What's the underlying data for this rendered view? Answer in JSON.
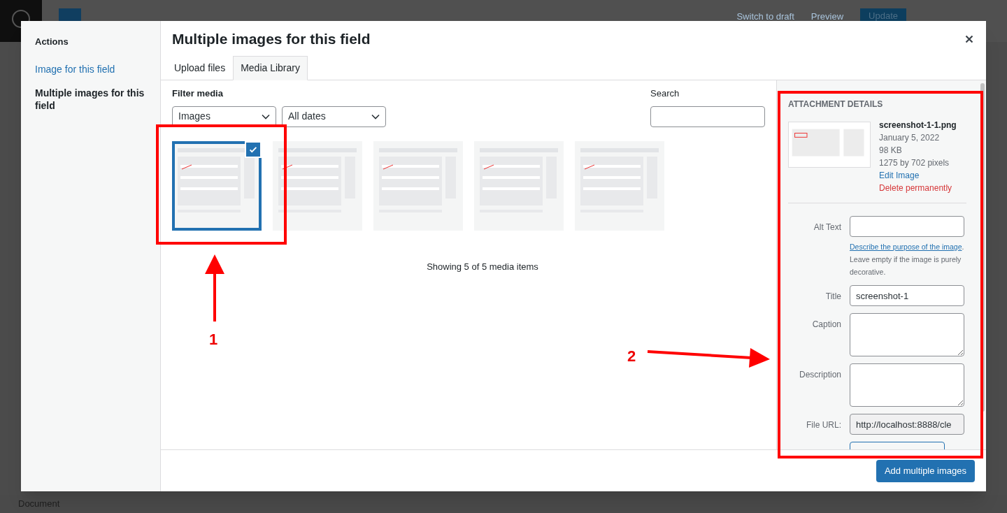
{
  "editor": {
    "toolbar": {
      "links": [
        "Switch to draft",
        "Preview"
      ],
      "primary_button": "Update"
    },
    "status_bar": "Document"
  },
  "modal": {
    "sidebar": {
      "heading": "Actions",
      "items": [
        {
          "label": "Image for this field",
          "selected": false
        },
        {
          "label": "Multiple images for this field",
          "selected": true
        }
      ]
    },
    "title": "Multiple images for this field",
    "tabs": [
      {
        "label": "Upload files",
        "selected": false
      },
      {
        "label": "Media Library",
        "selected": true
      }
    ],
    "filter": {
      "label": "Filter media",
      "type": "Images",
      "date": "All dates"
    },
    "search": {
      "label": "Search"
    },
    "media": [
      {
        "selected": true
      },
      {
        "selected": false
      },
      {
        "selected": false
      },
      {
        "selected": false
      },
      {
        "selected": false
      }
    ],
    "count_text": "Showing 5 of 5 media items",
    "details": {
      "heading": "ATTACHMENT DETAILS",
      "filename": "screenshot-1-1.png",
      "date": "January 5, 2022",
      "size": "98 KB",
      "dimensions": "1275 by 702 pixels",
      "edit_link": "Edit Image",
      "delete_link": "Delete permanently",
      "fields": [
        {
          "kind": "input",
          "label": "Alt Text",
          "help_link": "Describe the purpose of the image",
          "help_text": ". Leave empty if the image is purely decorative."
        },
        {
          "kind": "input",
          "label": "Title",
          "value": "screenshot-1"
        },
        {
          "kind": "textarea",
          "label": "Caption"
        },
        {
          "kind": "textarea",
          "label": "Description"
        },
        {
          "kind": "readonly",
          "label": "File URL:",
          "value": "http://localhost:8888/cle"
        }
      ]
    },
    "footer_button": "Add multiple images"
  },
  "annotations": [
    {
      "label": "1"
    },
    {
      "label": "2"
    }
  ]
}
